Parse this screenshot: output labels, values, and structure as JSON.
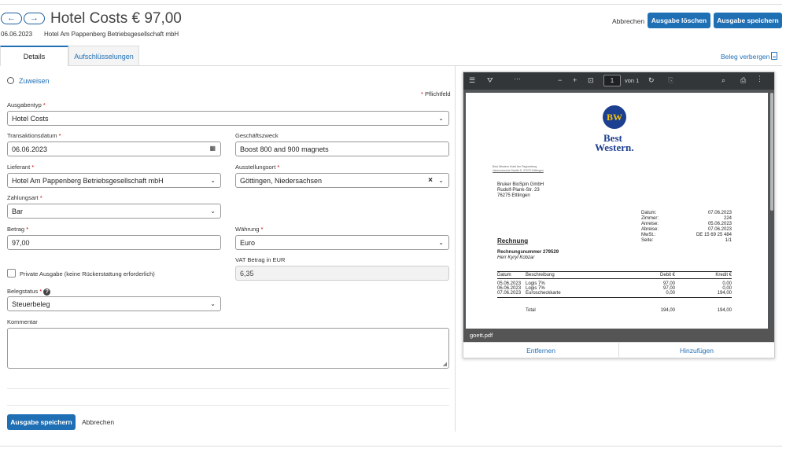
{
  "header": {
    "back_icon": "←",
    "forward_icon": "→",
    "title": "Hotel Costs € 97,00",
    "date": "06.06.2023",
    "vendor": "Hotel Am Pappenberg Betriebsgesellschaft mbH",
    "cancel_label": "Abbrechen",
    "delete_label": "Ausgabe löschen",
    "save_label": "Ausgabe speichern"
  },
  "tabs": [
    {
      "label": "Details",
      "active": true
    },
    {
      "label": "Aufschlüsselungen",
      "active": false
    }
  ],
  "receipt_toggle": "Beleg verbergen",
  "form": {
    "assign_label": "Zuweisen",
    "required_note": "Pflichtfeld",
    "expense_type": {
      "label": "Ausgabentyp",
      "value": "Hotel Costs"
    },
    "transaction_date": {
      "label": "Transaktionsdatum",
      "value": "06.06.2023"
    },
    "business_purpose": {
      "label": "Geschäftszweck",
      "value": "Boost 800 and 900 magnets"
    },
    "supplier": {
      "label": "Lieferant",
      "value": "Hotel Am Pappenberg Betriebsgesellschaft mbH"
    },
    "issue_place": {
      "label": "Ausstellungsort",
      "value": "Göttingen, Niedersachsen"
    },
    "payment_type": {
      "label": "Zahlungsart",
      "value": "Bar"
    },
    "amount": {
      "label": "Betrag",
      "value": "97,00"
    },
    "currency": {
      "label": "Währung",
      "value": "Euro"
    },
    "vat": {
      "label": "VAT Betrag in EUR",
      "value": "6,35"
    },
    "private": {
      "label": "Private Ausgabe (keine Rückerstattung erforderlich)"
    },
    "receipt_status": {
      "label": "Belegstatus",
      "value": "Steuerbeleg"
    },
    "comment": {
      "label": "Kommentar",
      "value": ""
    },
    "save_label": "Ausgabe speichern",
    "cancel_label": "Abbrechen"
  },
  "pdf": {
    "page_number": "1",
    "page_total": "von 1",
    "file_name": "goett.pdf",
    "remove_label": "Entfernen",
    "add_label": "Hinzufügen",
    "logo_line1": "Best",
    "logo_line2": "Western.",
    "logo_badge": "BW",
    "sender_line1": "Best Western Hotel Am Pappenberg",
    "sender_line2": "Hannoversche Straße 5, 37075 Göttingen",
    "recipient": [
      "Bruker BioSpin GmbH",
      "Rudolf-Plank-Str. 23",
      "76275 Ettlingen"
    ],
    "meta": [
      {
        "k": "Datum:",
        "v": "07.06.2023"
      },
      {
        "k": "Zimmer:",
        "v": "224"
      },
      {
        "k": "Anreise:",
        "v": "05.06.2023"
      },
      {
        "k": "Abreise:",
        "v": "07.06.2023"
      },
      {
        "k": "MwSt.:",
        "v": "DE 15 69 25 484"
      },
      {
        "k": "Seite:",
        "v": "1/1"
      }
    ],
    "heading": "Rechnung",
    "invoice_no": "Rechnungsnummer 279529",
    "guest": "Herr Kyryl Kobzar",
    "table_head": [
      "Datum",
      "Beschreibung",
      "Debit €",
      "Kredit €"
    ],
    "rows": [
      [
        "05.06.2023",
        "Logis 7%",
        "97,00",
        "0,00"
      ],
      [
        "06.06.2023",
        "Logis 7%",
        "97,00",
        "0,00"
      ],
      [
        "07.06.2023",
        "Euroscheckkarte",
        "0,00",
        "194,00"
      ]
    ],
    "total_label": "Total",
    "total_debit": "194,00",
    "total_credit": "194,00"
  },
  "colors": {
    "accent": "#1f6fb5",
    "required": "#cc0000",
    "pdf_toolbar": "#323639"
  }
}
